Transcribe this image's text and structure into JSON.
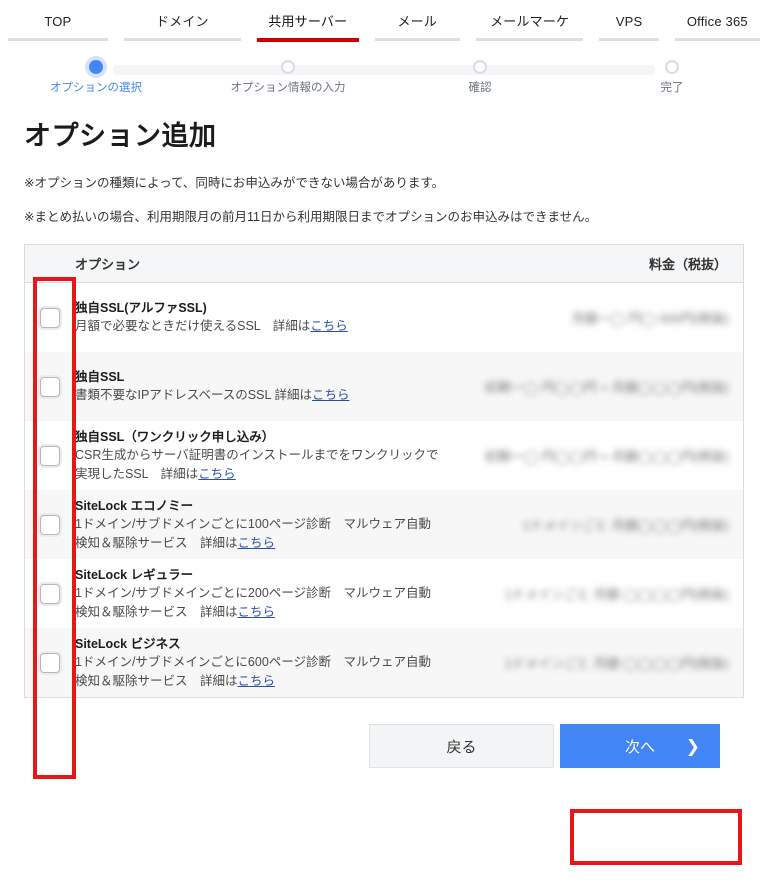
{
  "globalnav": {
    "items": [
      {
        "label": "TOP",
        "active": false
      },
      {
        "label": "ドメイン",
        "active": false
      },
      {
        "label": "共用サーバー",
        "active": true
      },
      {
        "label": "メール",
        "active": false
      },
      {
        "label": "メールマーケ",
        "active": false
      },
      {
        "label": "VPS",
        "active": false
      },
      {
        "label": "Office 365",
        "active": false
      }
    ]
  },
  "stepper": {
    "steps": [
      {
        "label": "オプションの選択",
        "state": "current"
      },
      {
        "label": "オプション情報の入力",
        "state": "todo"
      },
      {
        "label": "確認",
        "state": "todo"
      },
      {
        "label": "完了",
        "state": "todo"
      }
    ]
  },
  "page": {
    "title": "オプション追加",
    "note1": "※オプションの種類によって、同時にお申込みができない場合があります。",
    "note2": "※まとめ払いの場合、利用期限月の前月11日から利用期限日までオプションのお申込みはできません。"
  },
  "table": {
    "header": {
      "option": "オプション",
      "price": "料金（税抜）"
    },
    "rows": [
      {
        "name": "独自SSL(アルファSSL)",
        "desc_before": "月額で必要なときだけ使えるSSL　詳細は",
        "link": "こちら",
        "desc_line2": "",
        "price": "月額一◯ 円◯ 000円(税抜)",
        "checked": false
      },
      {
        "name": "独自SSL",
        "desc_before": "書類不要なIPアドレスベースのSSL 詳細は",
        "link": "こちら",
        "desc_line2": "",
        "price": "初期一◯ 円◯◯円 + 月額◯◯◯円(税抜)",
        "checked": false
      },
      {
        "name": "独自SSL（ワンクリック申し込み）",
        "desc_before": "CSR生成からサーバ証明書のインストールまでをワンクリックで",
        "desc_line2": "実現したSSL　詳細は",
        "link": "こちら",
        "price": "初期一◯ 円◯◯円 + 月額◯◯◯円(税抜)",
        "checked": false
      },
      {
        "name": "SiteLock エコノミー",
        "desc_before": "1ドメイン/サブドメインごとに100ページ診断　マルウェア自動",
        "desc_line2": "検知＆駆除サービス　詳細は",
        "link": "こちら",
        "price": "1ドメインごと 月額◯◯◯円(税抜)",
        "checked": false
      },
      {
        "name": "SiteLock レギュラー",
        "desc_before": "1ドメイン/サブドメインごとに200ページ診断　マルウェア自動",
        "desc_line2": "検知＆駆除サービス　詳細は",
        "link": "こちら",
        "price": "1ドメインごと 月額 ◯◯◯◯円(税抜)",
        "checked": false
      },
      {
        "name": "SiteLock ビジネス",
        "desc_before": "1ドメイン/サブドメインごとに600ページ診断　マルウェア自動",
        "desc_line2": "検知＆駆除サービス　詳細は",
        "link": "こちら",
        "price": "1ドメインごと 月額 ◯◯◯◯円(税抜)",
        "checked": false
      }
    ]
  },
  "actions": {
    "back": "戻る",
    "next": "次へ",
    "next_chevron": "❯"
  },
  "colors": {
    "accent_blue": "#4285f4",
    "tab_active_red": "#cc0000",
    "annotation_red": "#e8161a",
    "link_blue": "#2b50a8",
    "row_alt_bg": "#f7f7f7",
    "table_header_bg": "#f5f6f7"
  }
}
